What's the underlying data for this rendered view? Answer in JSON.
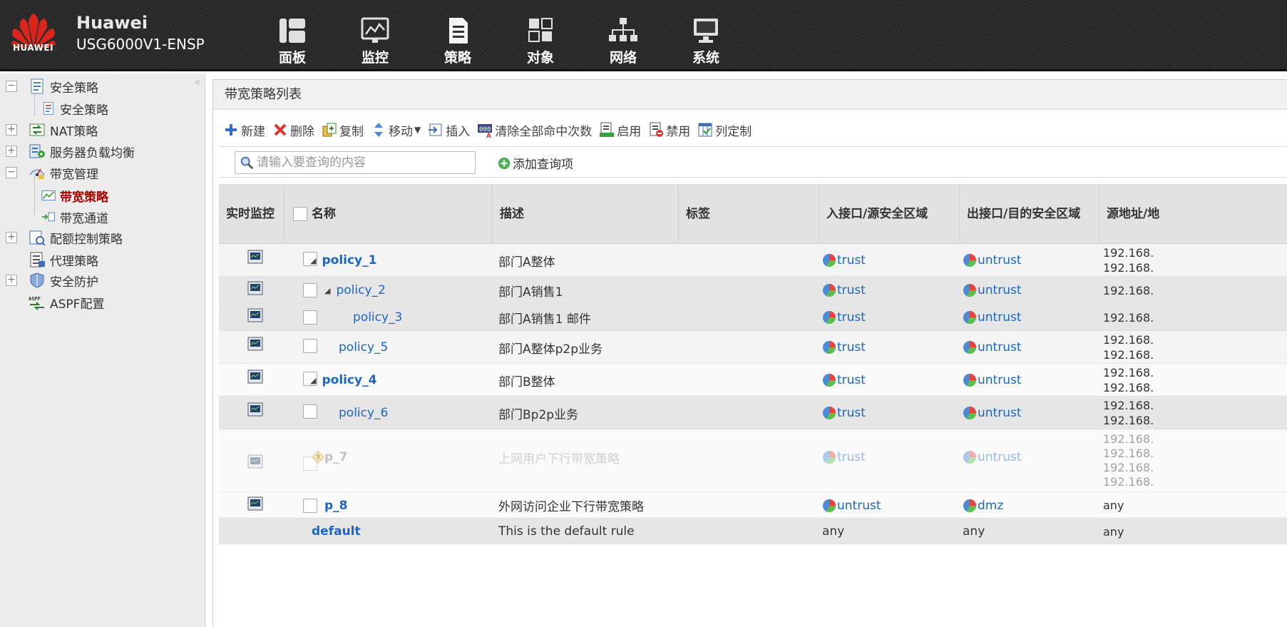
{
  "header": {
    "logo_text": "HUAWEI",
    "brand": "Huawei",
    "model": "USG6000V1-ENSP",
    "nav": [
      {
        "label": "面板",
        "icon": "dashboard-icon"
      },
      {
        "label": "监控",
        "icon": "monitor-icon"
      },
      {
        "label": "策略",
        "icon": "policy-document-icon"
      },
      {
        "label": "对象",
        "icon": "object-icon"
      },
      {
        "label": "网络",
        "icon": "network-icon"
      },
      {
        "label": "系统",
        "icon": "system-icon"
      }
    ]
  },
  "sidebar": {
    "collapse_glyph": "«",
    "items": [
      {
        "label": "安全策略",
        "toggle": "−"
      },
      {
        "label": "安全策略"
      },
      {
        "label": "NAT策略",
        "toggle": "+"
      },
      {
        "label": "服务器负载均衡",
        "toggle": "+"
      },
      {
        "label": "带宽管理",
        "toggle": "−"
      },
      {
        "label": "带宽策略"
      },
      {
        "label": "带宽通道"
      },
      {
        "label": "配额控制策略",
        "toggle": "+"
      },
      {
        "label": "代理策略"
      },
      {
        "label": "安全防护",
        "toggle": "+"
      },
      {
        "label": "ASPF配置"
      }
    ]
  },
  "panel": {
    "title": "带宽策略列表",
    "toolbar": {
      "new": "新建",
      "delete": "删除",
      "copy": "复制",
      "move": "移动",
      "insert": "插入",
      "clear_hits": "清除全部命中次数",
      "enable": "启用",
      "disable": "禁用",
      "columns": "列定制"
    },
    "search": {
      "placeholder": "请输入要查询的内容",
      "add_query": "添加查询项"
    }
  },
  "table": {
    "columns": [
      "实时监控",
      "名称",
      "描述",
      "标签",
      "入接口/源安全区域",
      "出接口/目的安全区域",
      "源地址/地"
    ],
    "rows": [
      {
        "name": "policy_1",
        "desc": "部门A整体",
        "src_zone": "trust",
        "dst_zone": "untrust",
        "src_addr": [
          "192.168.",
          "192.168."
        ]
      },
      {
        "name": "policy_2",
        "desc": "部门A销售1",
        "src_zone": "trust",
        "dst_zone": "untrust",
        "src_addr": [
          "192.168."
        ]
      },
      {
        "name": "policy_3",
        "desc": "部门A销售1 邮件",
        "src_zone": "trust",
        "dst_zone": "untrust",
        "src_addr": [
          "192.168."
        ]
      },
      {
        "name": "policy_5",
        "desc": "部门A整体p2p业务",
        "src_zone": "trust",
        "dst_zone": "untrust",
        "src_addr": [
          "192.168.",
          "192.168."
        ]
      },
      {
        "name": "policy_4",
        "desc": "部门B整体",
        "src_zone": "trust",
        "dst_zone": "untrust",
        "src_addr": [
          "192.168.",
          "192.168."
        ]
      },
      {
        "name": "policy_6",
        "desc": "部门Bp2p业务",
        "src_zone": "trust",
        "dst_zone": "untrust",
        "src_addr": [
          "192.168.",
          "192.168."
        ]
      },
      {
        "name": "p_7",
        "desc": "上网用户下行带宽策略",
        "src_zone": "trust",
        "dst_zone": "untrust",
        "src_addr": [
          "192.168.",
          "192.168.",
          "192.168.",
          "192.168."
        ]
      },
      {
        "name": "p_8",
        "desc": "外网访问企业下行带宽策略",
        "src_zone": "untrust",
        "dst_zone": "dmz",
        "src_addr": [
          "any"
        ]
      },
      {
        "name": "default",
        "desc": "This is the default rule",
        "src_zone": "any",
        "dst_zone": "any",
        "src_addr": [
          "any"
        ]
      }
    ]
  },
  "colors": {
    "link": "#1a66c8",
    "active_tree": "#aa0000",
    "brand_red": "#d9261c"
  }
}
